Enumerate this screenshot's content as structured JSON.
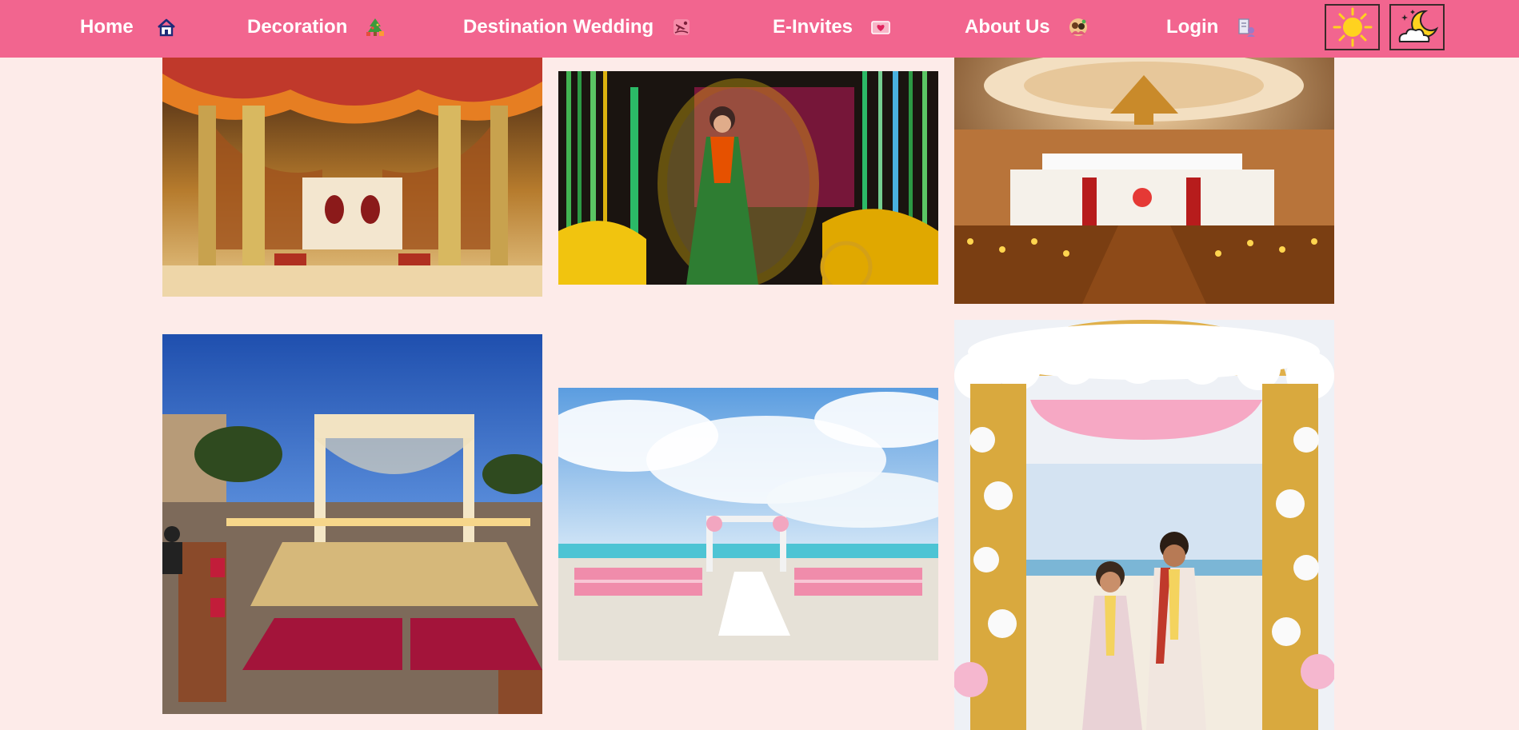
{
  "nav": {
    "items": [
      {
        "label": "Home",
        "icon": "house-icon"
      },
      {
        "label": "Decoration",
        "icon": "christmas-tree-icon"
      },
      {
        "label": "Destination Wedding",
        "icon": "airplane-destination-icon"
      },
      {
        "label": "E-Invites",
        "icon": "love-letter-icon"
      },
      {
        "label": "About Us",
        "icon": "couple-icon"
      },
      {
        "label": "Login",
        "icon": "login-user-icon"
      }
    ],
    "light_mode_icon": "sun-icon",
    "dark_mode_icon": "moon-cloud-icon"
  },
  "gallery": {
    "images": [
      {
        "name": "golden-mandap-with-floral-canopy"
      },
      {
        "name": "bride-in-floral-carriage"
      },
      {
        "name": "indoor-ballroom-mandap"
      },
      {
        "name": "palace-courtyard-mandap-at-dusk"
      },
      {
        "name": "beach-ceremony-aisle"
      },
      {
        "name": "beach-floral-mandap-couple"
      }
    ]
  },
  "colors": {
    "navbar": "#f2658f",
    "page_background": "#fdebe9",
    "nav_text": "#ffffff"
  }
}
